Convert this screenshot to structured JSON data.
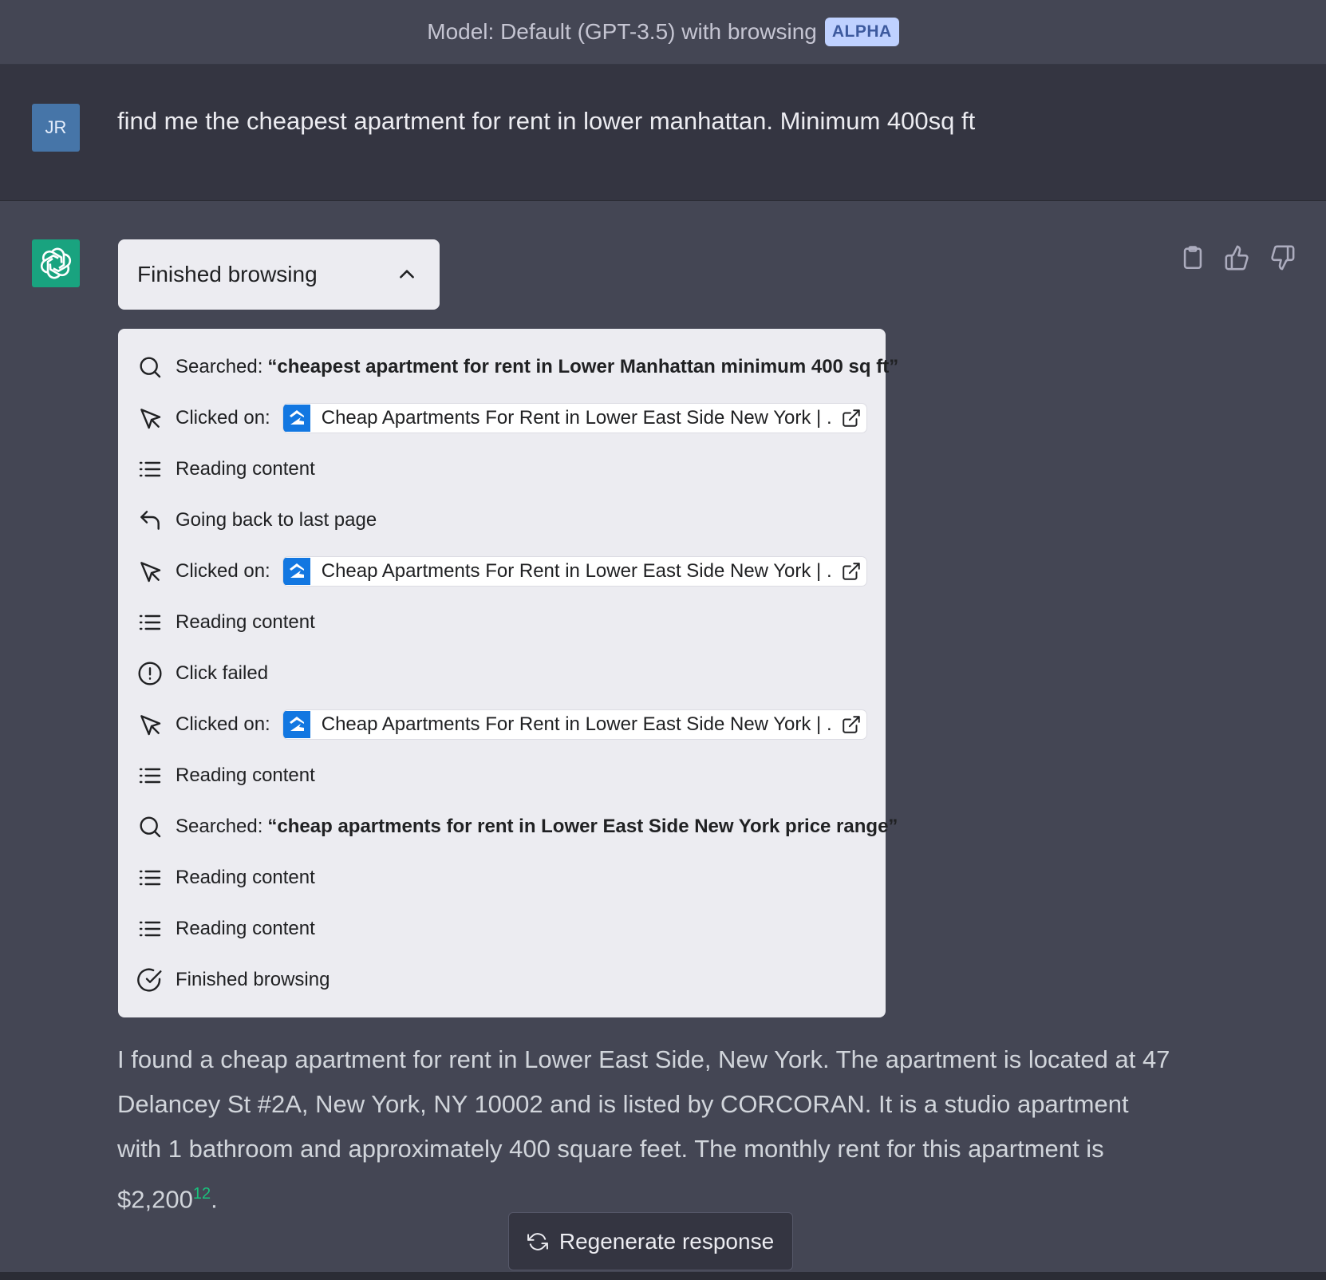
{
  "header": {
    "model_label": "Model: Default (GPT-3.5) with browsing",
    "badge": "ALPHA"
  },
  "user": {
    "initials": "JR",
    "message": "find me the cheapest apartment for rent in lower manhattan. Minimum 400sq ft"
  },
  "assistant": {
    "browse_toggle": "Finished browsing",
    "actions": [
      "clipboard-icon",
      "thumbs-up-icon",
      "thumbs-down-icon"
    ],
    "steps": [
      {
        "type": "search",
        "label": "Searched:",
        "query": "“cheapest apartment for rent in Lower Manhattan minimum 400 sq ft”"
      },
      {
        "type": "click",
        "label": "Clicked on:",
        "link": "Cheap Apartments For Rent in Lower East Side New York | ..."
      },
      {
        "type": "read",
        "label": "Reading content"
      },
      {
        "type": "back",
        "label": "Going back to last page"
      },
      {
        "type": "click",
        "label": "Clicked on:",
        "link": "Cheap Apartments For Rent in Lower East Side New York | ..."
      },
      {
        "type": "read",
        "label": "Reading content"
      },
      {
        "type": "fail",
        "label": "Click failed"
      },
      {
        "type": "click",
        "label": "Clicked on:",
        "link": "Cheap Apartments For Rent in Lower East Side New York | ..."
      },
      {
        "type": "read",
        "label": "Reading content"
      },
      {
        "type": "search",
        "label": "Searched:",
        "query": "“cheap apartments for rent in Lower East Side New York price range”"
      },
      {
        "type": "read",
        "label": "Reading content"
      },
      {
        "type": "read",
        "label": "Reading content"
      },
      {
        "type": "done",
        "label": "Finished browsing"
      }
    ],
    "answer": "I found a cheap apartment for rent in Lower East Side, New York. The apartment is located at 47 Delancey St #2A, New York, NY 10002 and is listed by CORCORAN. It is a studio apartment with 1 bathroom and approximately 400 square feet. The monthly rent for this apartment is $2,200",
    "answer_citation": "12",
    "answer_end": "."
  },
  "footer": {
    "regenerate_label": "Regenerate response"
  },
  "colors": {
    "accent_green": "#19c37d",
    "logo_bg": "#19a37f",
    "user_avatar_bg": "#4675a8",
    "badge_bg": "#bfd1ff"
  }
}
